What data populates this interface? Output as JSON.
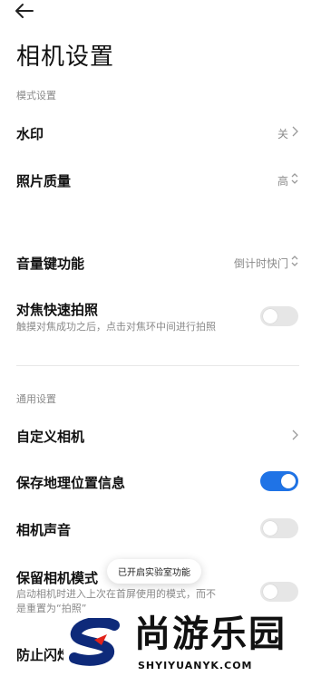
{
  "header": {
    "back_icon": "arrow-left-icon",
    "title": "相机设置"
  },
  "sections": {
    "mode": "模式设置",
    "general": "通用设置"
  },
  "rows": {
    "watermark": {
      "label": "水印",
      "value": "关",
      "icon": "chevron-right-icon"
    },
    "photo_quality": {
      "label": "照片质量",
      "value": "高",
      "icon": "up-down-chevron-icon"
    },
    "volume_key": {
      "label": "音量键功能",
      "value": "倒计时快门",
      "icon": "up-down-chevron-icon"
    },
    "focus_shoot": {
      "label": "对焦快速拍照",
      "sub": "触摸对焦成功之后，点击对焦环中间进行拍照",
      "toggle": false
    },
    "custom_camera": {
      "label": "自定义相机",
      "icon": "chevron-right-icon"
    },
    "save_location": {
      "label": "保存地理位置信息",
      "toggle": true
    },
    "camera_sound": {
      "label": "相机声音",
      "toggle": false
    },
    "keep_mode": {
      "label": "保留相机模式",
      "sub_line1": "启动相机时进入上次在首屏使用的模式，而不",
      "sub_line2": "是重置为“拍照”",
      "toggle": false
    },
    "anti_flicker": {
      "label": "防止闪烁"
    }
  },
  "toast": {
    "text": "已开启实验室功能"
  },
  "watermark_overlay": {
    "brand": "尚游乐园",
    "url": "SHYIYUANYK.COM"
  },
  "colors": {
    "accent": "#1f73e6",
    "muted": "#8a8a8a",
    "toggle_off": "#e6e6e6",
    "watermark_logo": "#0e2a7a"
  }
}
